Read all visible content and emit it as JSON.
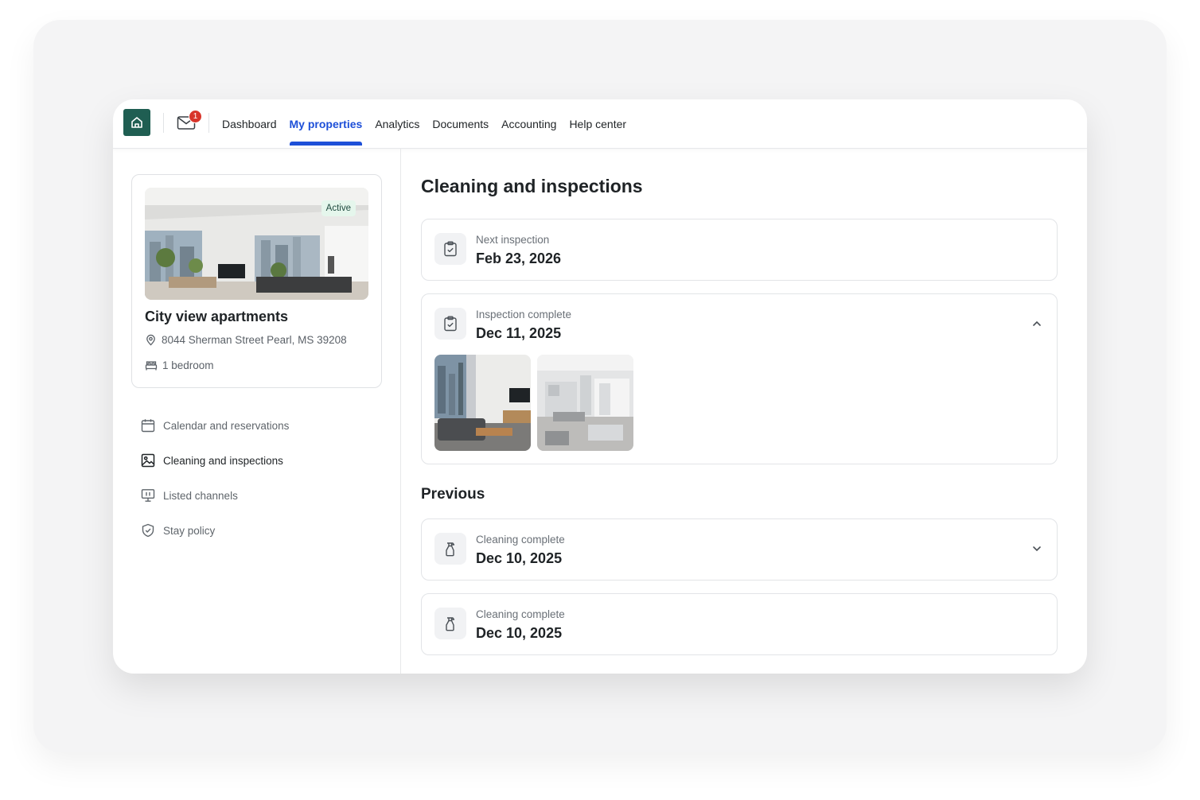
{
  "nav": {
    "notification_count": "1",
    "items": [
      {
        "label": "Dashboard",
        "active": false
      },
      {
        "label": "My properties",
        "active": true
      },
      {
        "label": "Analytics",
        "active": false
      },
      {
        "label": "Documents",
        "active": false
      },
      {
        "label": "Accounting",
        "active": false
      },
      {
        "label": "Help center",
        "active": false
      }
    ]
  },
  "property": {
    "status": "Active",
    "name": "City view apartments",
    "address": "8044 Sherman Street Pearl, MS 39208",
    "bedrooms": "1 bedroom"
  },
  "sidebar": {
    "items": [
      {
        "label": "Calendar and reservations",
        "icon": "calendar-icon",
        "current": false
      },
      {
        "label": "Cleaning and inspections",
        "icon": "image-icon",
        "current": true
      },
      {
        "label": "Listed channels",
        "icon": "monitor-icon",
        "current": false
      },
      {
        "label": "Stay policy",
        "icon": "shield-check-icon",
        "current": false
      }
    ]
  },
  "main": {
    "title": "Cleaning and inspections",
    "next": {
      "label": "Next inspection",
      "date": "Feb 23, 2026",
      "icon": "clipboard-check-icon"
    },
    "complete": {
      "label": "Inspection complete",
      "date": "Dec 11, 2025",
      "icon": "clipboard-check-icon",
      "expanded": true
    },
    "previous_title": "Previous",
    "previous": [
      {
        "label": "Cleaning complete",
        "date": "Dec 10, 2025",
        "icon": "spray-bottle-icon",
        "chevron": "chevron-down-icon"
      },
      {
        "label": "Cleaning complete",
        "date": "Dec 10, 2025",
        "icon": "spray-bottle-icon"
      }
    ]
  },
  "colors": {
    "accent": "#1d4fd8",
    "brand": "#1f5e52",
    "badge": "#d8352b",
    "active_pill_bg": "#e5f6ec"
  }
}
